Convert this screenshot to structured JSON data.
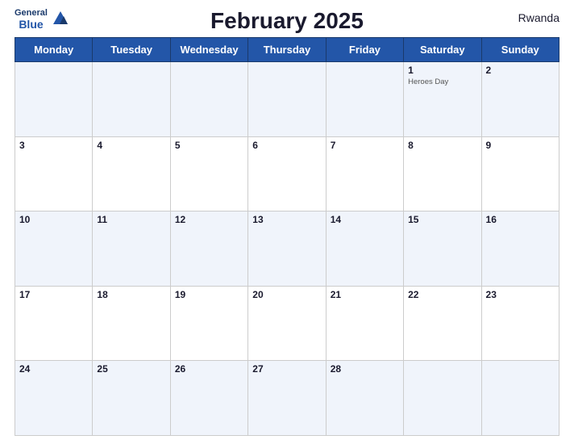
{
  "header": {
    "title": "February 2025",
    "country": "Rwanda",
    "logo": {
      "line1": "General",
      "line2": "Blue"
    }
  },
  "calendar": {
    "days_of_week": [
      "Monday",
      "Tuesday",
      "Wednesday",
      "Thursday",
      "Friday",
      "Saturday",
      "Sunday"
    ],
    "weeks": [
      [
        {
          "num": "",
          "empty": true
        },
        {
          "num": "",
          "empty": true
        },
        {
          "num": "",
          "empty": true
        },
        {
          "num": "",
          "empty": true
        },
        {
          "num": "",
          "empty": true
        },
        {
          "num": "1",
          "holiday": "Heroes Day"
        },
        {
          "num": "2"
        }
      ],
      [
        {
          "num": "3"
        },
        {
          "num": "4"
        },
        {
          "num": "5"
        },
        {
          "num": "6"
        },
        {
          "num": "7"
        },
        {
          "num": "8"
        },
        {
          "num": "9"
        }
      ],
      [
        {
          "num": "10"
        },
        {
          "num": "11"
        },
        {
          "num": "12"
        },
        {
          "num": "13"
        },
        {
          "num": "14"
        },
        {
          "num": "15"
        },
        {
          "num": "16"
        }
      ],
      [
        {
          "num": "17"
        },
        {
          "num": "18"
        },
        {
          "num": "19"
        },
        {
          "num": "20"
        },
        {
          "num": "21"
        },
        {
          "num": "22"
        },
        {
          "num": "23"
        }
      ],
      [
        {
          "num": "24"
        },
        {
          "num": "25"
        },
        {
          "num": "26"
        },
        {
          "num": "27"
        },
        {
          "num": "28"
        },
        {
          "num": "",
          "empty": true
        },
        {
          "num": "",
          "empty": true
        }
      ]
    ]
  },
  "colors": {
    "header_bg": "#2356a8",
    "header_text": "#ffffff",
    "title_color": "#1a1a2e",
    "odd_row_bg": "#e8eef8",
    "even_row_bg": "#ffffff"
  }
}
